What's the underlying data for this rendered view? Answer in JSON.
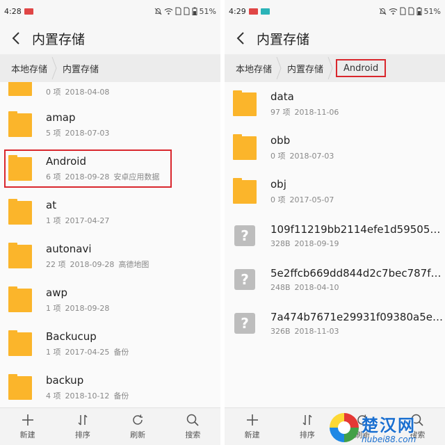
{
  "left": {
    "status": {
      "time": "4:28",
      "battery": "51%"
    },
    "title": "内置存储",
    "breadcrumb": [
      "本地存储",
      "内置存储"
    ],
    "files": [
      {
        "name": "",
        "count": "0 项",
        "date": "2018-04-08",
        "desc": ""
      },
      {
        "name": "amap",
        "count": "5 项",
        "date": "2018-07-03",
        "desc": ""
      },
      {
        "name": "Android",
        "count": "6 项",
        "date": "2018-09-28",
        "desc": "安卓应用数据"
      },
      {
        "name": "at",
        "count": "1 项",
        "date": "2017-04-27",
        "desc": ""
      },
      {
        "name": "autonavi",
        "count": "22 项",
        "date": "2018-09-28",
        "desc": "高德地图"
      },
      {
        "name": "awp",
        "count": "1 项",
        "date": "2018-09-28",
        "desc": ""
      },
      {
        "name": "Backucup",
        "count": "1 项",
        "date": "2017-04-25",
        "desc": "备份"
      },
      {
        "name": "backup",
        "count": "4 项",
        "date": "2018-10-12",
        "desc": "备份"
      }
    ],
    "toolbar": [
      "新建",
      "排序",
      "刷新",
      "搜索"
    ]
  },
  "right": {
    "status": {
      "time": "4:29",
      "battery": "51%"
    },
    "title": "内置存储",
    "breadcrumb": [
      "本地存储",
      "内置存储",
      "Android"
    ],
    "files": [
      {
        "name": "data",
        "count": "97 项",
        "date": "2018-11-06"
      },
      {
        "name": "obb",
        "count": "0 项",
        "date": "2018-07-03"
      },
      {
        "name": "obj",
        "count": "0 项",
        "date": "2017-05-07"
      },
      {
        "name": "109f11219bb2114efe1d59505af97...",
        "count": "328B",
        "date": "2018-09-19"
      },
      {
        "name": "5e2ffcb669dd844d2c7bec787f408...",
        "count": "248B",
        "date": "2018-04-10"
      },
      {
        "name": "7a474b7671e29931f09380a5ecba...",
        "count": "326B",
        "date": "2018-11-03"
      }
    ],
    "toolbar": [
      "新建",
      "排序",
      "刷新",
      "搜索"
    ]
  },
  "watermark": {
    "cn": "楚汉网",
    "url": "hubei88.com"
  },
  "colors": {
    "folder": "#fbb52b",
    "highlight": "#d9262c",
    "breadcrumb_bg": "#ececec"
  },
  "icons": [
    "back-arrow-icon",
    "folder-icon",
    "unknown-file-icon",
    "plus-icon",
    "sort-icon",
    "refresh-icon",
    "search-icon",
    "mute-icon",
    "wifi-icon",
    "sim-icon",
    "battery-icon"
  ]
}
